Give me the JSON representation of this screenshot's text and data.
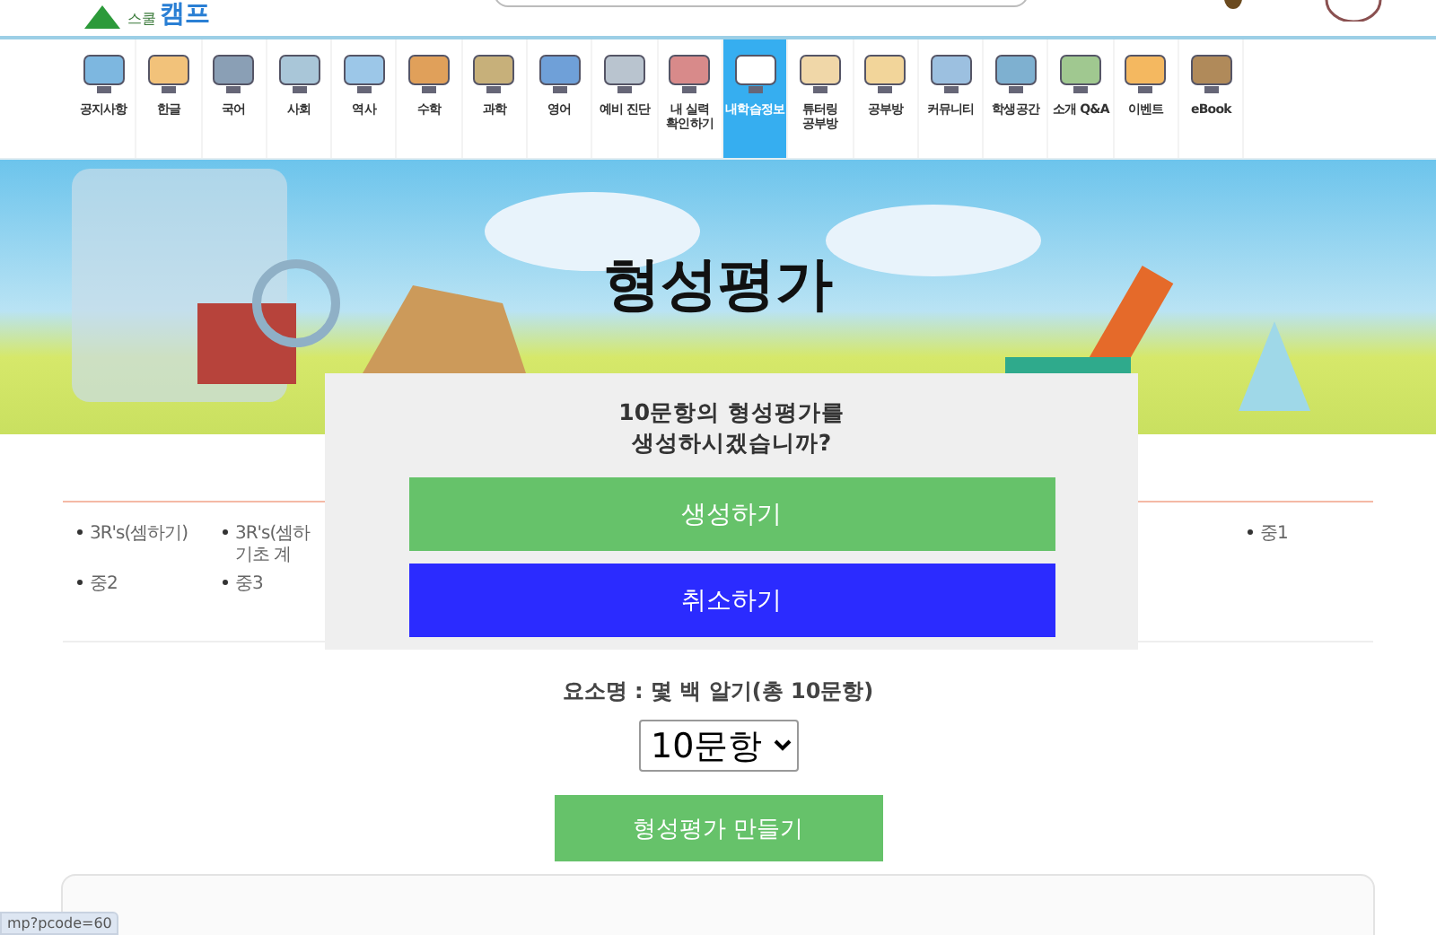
{
  "header": {
    "logo": {
      "small": "스쿨",
      "big": "캠프"
    }
  },
  "nav": [
    {
      "label": "공지사항",
      "selected": false
    },
    {
      "label": "한글",
      "selected": false
    },
    {
      "label": "국어",
      "selected": false
    },
    {
      "label": "사회",
      "selected": false
    },
    {
      "label": "역사",
      "selected": false
    },
    {
      "label": "수학",
      "selected": false
    },
    {
      "label": "과학",
      "selected": false
    },
    {
      "label": "영어",
      "selected": false
    },
    {
      "label": "예비 진단",
      "selected": false
    },
    {
      "label": "내 실력\n확인하기",
      "selected": false
    },
    {
      "label": "내학습정보",
      "selected": true
    },
    {
      "label": "튜터링\n공부방",
      "selected": false
    },
    {
      "label": "공부방",
      "selected": false
    },
    {
      "label": "커뮤니티",
      "selected": false
    },
    {
      "label": "학생공간",
      "selected": false
    },
    {
      "label": "소개 Q&A",
      "selected": false
    },
    {
      "label": "이벤트",
      "selected": false
    },
    {
      "label": "eBook",
      "selected": false
    }
  ],
  "banner": {
    "title": "형성평가"
  },
  "topic_list": {
    "left": [
      "3R's(셈하기)",
      "3R's(셈하\n기초 계",
      "중2",
      "중3"
    ],
    "right": [
      "중1"
    ]
  },
  "element_name": "요소명 : 몇 백 알기(총 10문항)",
  "question_count": {
    "value": "10문항"
  },
  "create_button": "형성평가 만들기",
  "dialog": {
    "message": "10문항의 형성평가를\n생성하시겠습니까?",
    "buttons": [
      {
        "label": "생성하기",
        "kind": "confirm"
      },
      {
        "label": "취소하기",
        "kind": "cancel"
      }
    ]
  },
  "status_url": "mp?pcode=60"
}
